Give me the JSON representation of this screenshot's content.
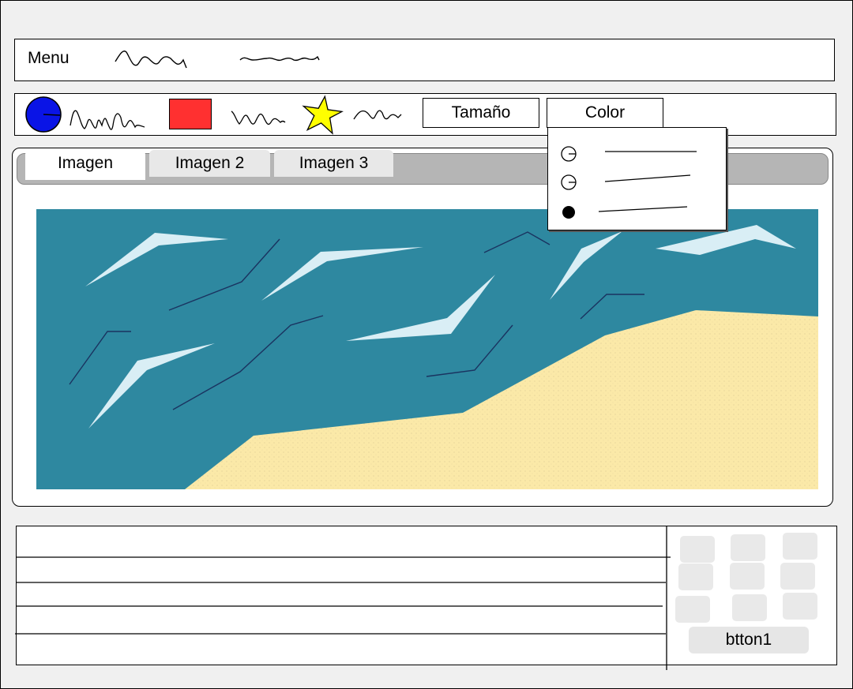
{
  "menubar": {
    "label": "Menu"
  },
  "toolbar": {
    "tamano_label": "Tamaño",
    "color_label": "Color",
    "circle_color": "#0a14e6",
    "square_color": "#ff3030",
    "star_color": "#ffff00"
  },
  "tabs": [
    {
      "label": "Imagen",
      "active": true
    },
    {
      "label": "Imagen 2",
      "active": false
    },
    {
      "label": "Imagen 3",
      "active": false
    }
  ],
  "dropdown": {
    "options": [
      {
        "selected": false
      },
      {
        "selected": false
      },
      {
        "selected": true
      }
    ]
  },
  "image": {
    "sea_color": "#2e88a0",
    "sand_color": "#fbe9a8",
    "bird_color": "#d9eef5"
  },
  "bottom": {
    "button_label": "btton1"
  }
}
